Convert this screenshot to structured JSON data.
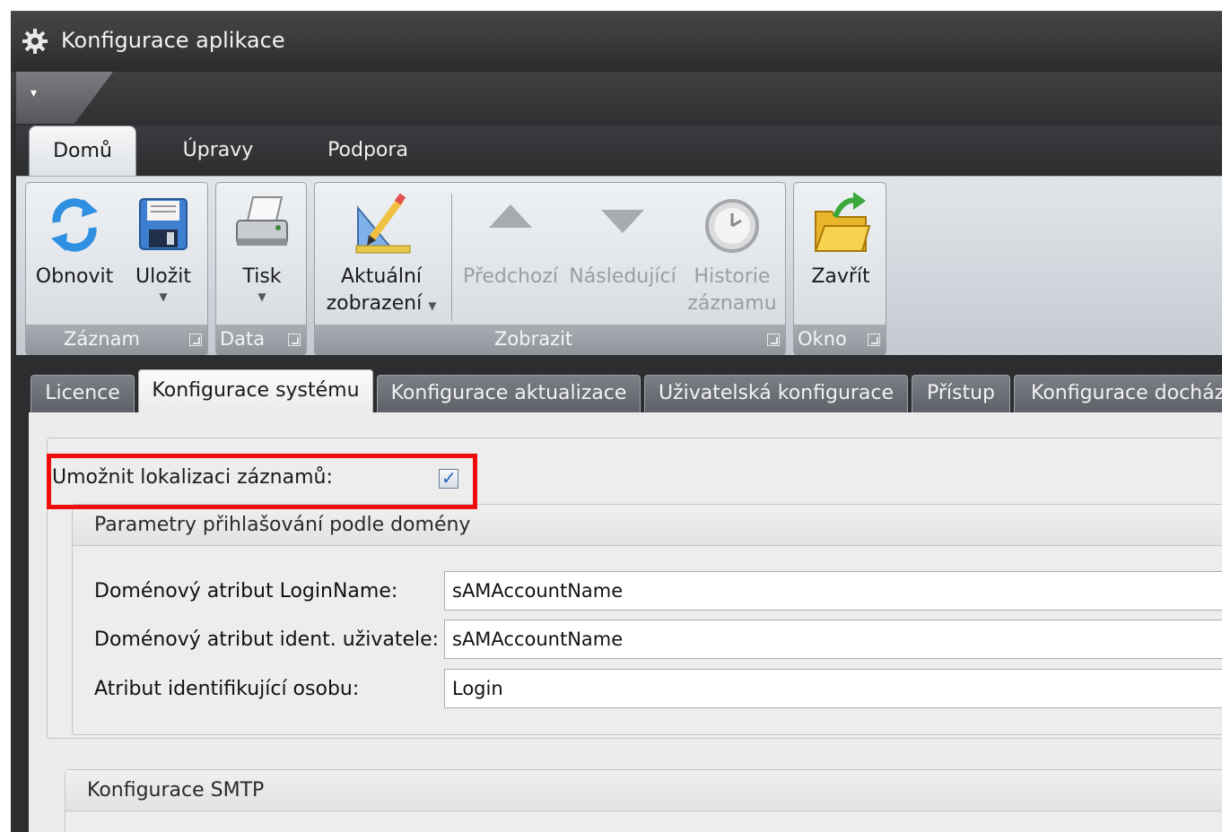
{
  "window": {
    "title": "Konfigurace aplikace",
    "icon": "gear-icon"
  },
  "ribbon_tabs": [
    {
      "label": "Domů",
      "active": true
    },
    {
      "label": "Úpravy",
      "active": false
    },
    {
      "label": "Podpora",
      "active": false
    }
  ],
  "ribbon": {
    "groups": [
      {
        "label": "Záznam"
      },
      {
        "label": "Data"
      },
      {
        "label": "Zobrazit"
      },
      {
        "label": "Okno"
      }
    ],
    "buttons": {
      "refresh": {
        "label": "Obnovit",
        "icon": "refresh-icon"
      },
      "save": {
        "label": "Uložit",
        "icon": "floppy-disk-icon"
      },
      "print": {
        "label": "Tisk",
        "icon": "printer-icon"
      },
      "current_view": {
        "label1": "Aktuální",
        "label2": "zobrazení",
        "icon": "ruler-pencil-icon"
      },
      "previous": {
        "label": "Předchozí",
        "icon": "up-triangle-icon"
      },
      "next": {
        "label": "Následující",
        "icon": "down-triangle-icon"
      },
      "history": {
        "label1": "Historie",
        "label2": "záznamu",
        "icon": "clock-icon"
      },
      "close": {
        "label": "Zavřít",
        "icon": "folder-exit-icon"
      }
    }
  },
  "content_tabs": [
    {
      "label": "Licence",
      "active": false
    },
    {
      "label": "Konfigurace systému",
      "active": true
    },
    {
      "label": "Konfigurace aktualizace",
      "active": false
    },
    {
      "label": "Uživatelská konfigurace",
      "active": false
    },
    {
      "label": "Přístup",
      "active": false
    },
    {
      "label": "Konfigurace docház",
      "active": false
    }
  ],
  "system_config": {
    "localization": {
      "label": "Umožnit lokalizaci záznamů:",
      "checked": true
    },
    "domain_login": {
      "title": "Parametry přihlašování podle domény",
      "fields": [
        {
          "label": "Doménový atribut LoginName:",
          "value": "sAMAccountName"
        },
        {
          "label": "Doménový atribut ident. uživatele:",
          "value": "sAMAccountName"
        },
        {
          "label": "Atribut identifikující osobu:",
          "value": "Login"
        }
      ]
    },
    "smtp": {
      "title": "Konfigurace SMTP"
    }
  },
  "colors": {
    "highlight": "#ee0c0c",
    "checkmark": "#1f5fb3"
  }
}
